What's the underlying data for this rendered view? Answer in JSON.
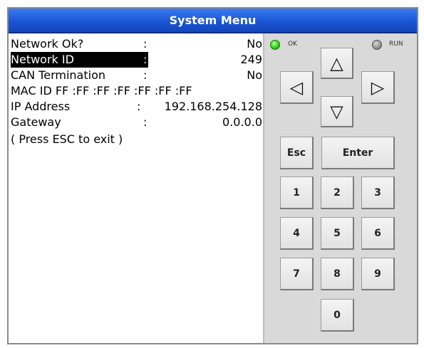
{
  "window": {
    "title": "System Menu"
  },
  "screen": {
    "rows": [
      {
        "label": "Network Ok?",
        "colon": ":",
        "value": "No"
      },
      {
        "label": "Network ID",
        "colon": ":",
        "value": "249"
      },
      {
        "label": "CAN Termination",
        "colon": ":",
        "value": "No"
      },
      {
        "label": "MAC ID  FF :FF :FF :FF :FF :FF :FF"
      },
      {
        "label": "IP Address",
        "colon": ":",
        "value": "192.168.254.128"
      },
      {
        "label": "Gateway",
        "colon": ":",
        "value": "0.0.0.0"
      },
      {
        "label": "( Press ESC to exit )"
      }
    ],
    "highlighted_row": 1
  },
  "keypad": {
    "indicators": {
      "ok_label": "OK",
      "run_label": "RUN",
      "ok_color": "#2fd014",
      "run_color": "#8f8f8f"
    },
    "arrows": {
      "up": "△",
      "down": "▽",
      "left": "◁",
      "right": "▷"
    },
    "esc_label": "Esc",
    "enter_label": "Enter",
    "digits": [
      "1",
      "2",
      "3",
      "4",
      "5",
      "6",
      "7",
      "8",
      "9",
      "0"
    ]
  }
}
